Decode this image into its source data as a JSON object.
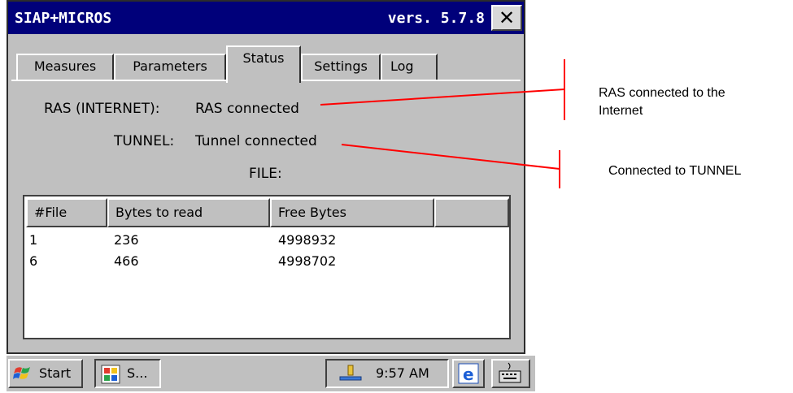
{
  "window": {
    "title": "SIAP+MICROS",
    "version": "vers. 5.7.8",
    "close_glyph": "✕"
  },
  "tabs": [
    {
      "label": "Measures",
      "active": false
    },
    {
      "label": "Parameters",
      "active": false
    },
    {
      "label": "Status",
      "active": true
    },
    {
      "label": "Settings",
      "active": false
    },
    {
      "label": "Log",
      "active": false
    }
  ],
  "status": {
    "ras_label": "RAS (INTERNET):",
    "ras_value": "RAS connected",
    "tunnel_label": "TUNNEL:",
    "tunnel_value": "Tunnel connected",
    "file_label": "FILE:"
  },
  "file_table": {
    "columns": [
      "#File",
      "Bytes to read",
      "Free Bytes",
      ""
    ],
    "rows": [
      [
        "1",
        "236",
        "4998932"
      ],
      [
        "6",
        "466",
        "4998702"
      ]
    ]
  },
  "taskbar": {
    "start_label": "Start",
    "app_label": "S...",
    "time": "9:57 AM"
  },
  "annotations": {
    "ras_note": [
      "RAS connected to the",
      "Internet"
    ],
    "tunnel_note": "Connected to TUNNEL",
    "line_color": "#ff0000"
  }
}
